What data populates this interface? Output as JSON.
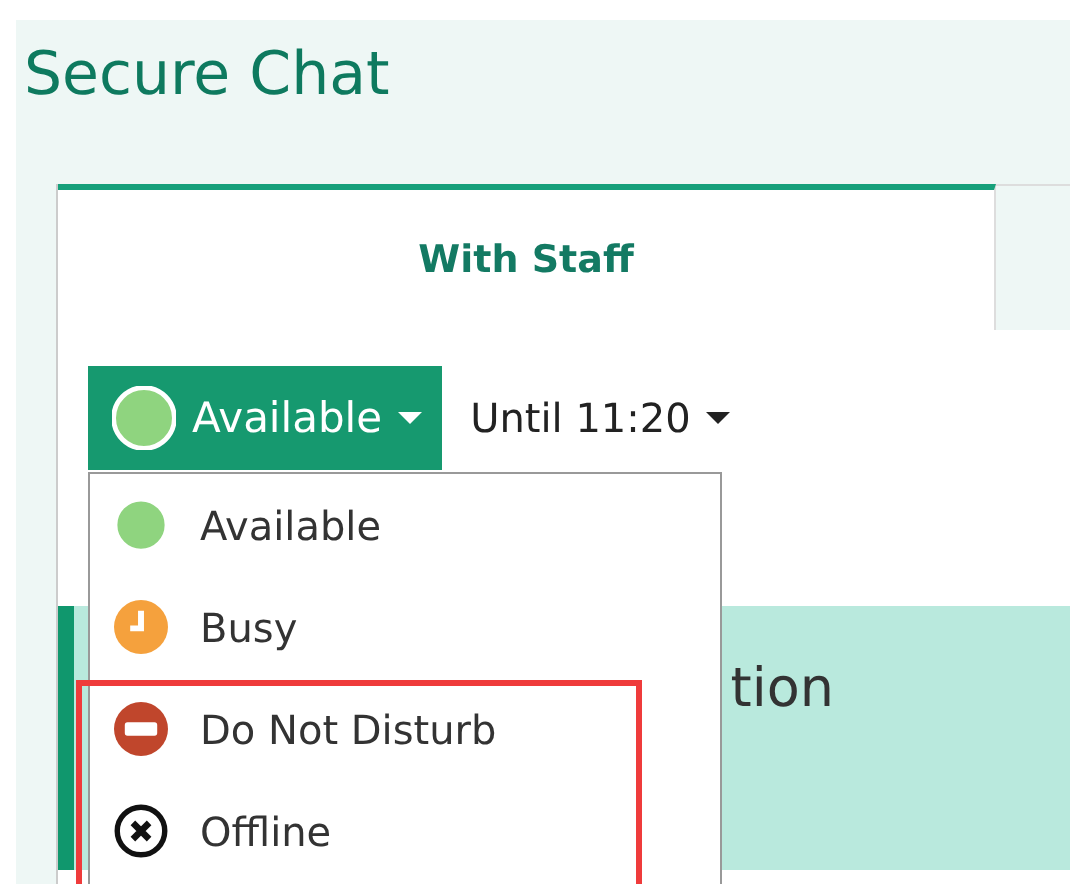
{
  "title": "Secure Chat",
  "tabs": [
    {
      "label": "With Staff",
      "selected": true
    }
  ],
  "status_button": {
    "label": "Available",
    "kind": "available"
  },
  "until": {
    "label": "Until 11:20"
  },
  "band_text": "tion",
  "status_menu": [
    {
      "label": "Available",
      "kind": "available",
      "highlighted": false
    },
    {
      "label": "Busy",
      "kind": "busy",
      "highlighted": false
    },
    {
      "label": "Do Not Disturb",
      "kind": "dnd",
      "highlighted": true
    },
    {
      "label": "Offline",
      "kind": "offline",
      "highlighted": true
    }
  ]
}
